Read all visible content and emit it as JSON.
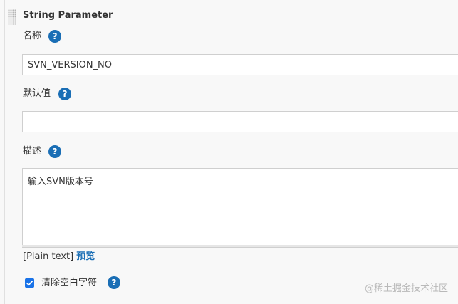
{
  "section": {
    "title": "String Parameter"
  },
  "fields": {
    "name": {
      "label": "名称",
      "value": "SVN_VERSION_NO",
      "help": "?"
    },
    "default": {
      "label": "默认值",
      "value": "",
      "help": "?"
    },
    "description": {
      "label": "描述",
      "value": "输入SVN版本号",
      "help": "?"
    }
  },
  "format": {
    "plain_text": "[Plain text]",
    "preview": "预览"
  },
  "trim": {
    "label": "清除空白字符",
    "checked": true,
    "help": "?"
  },
  "watermark": "@稀土掘金技术社区"
}
